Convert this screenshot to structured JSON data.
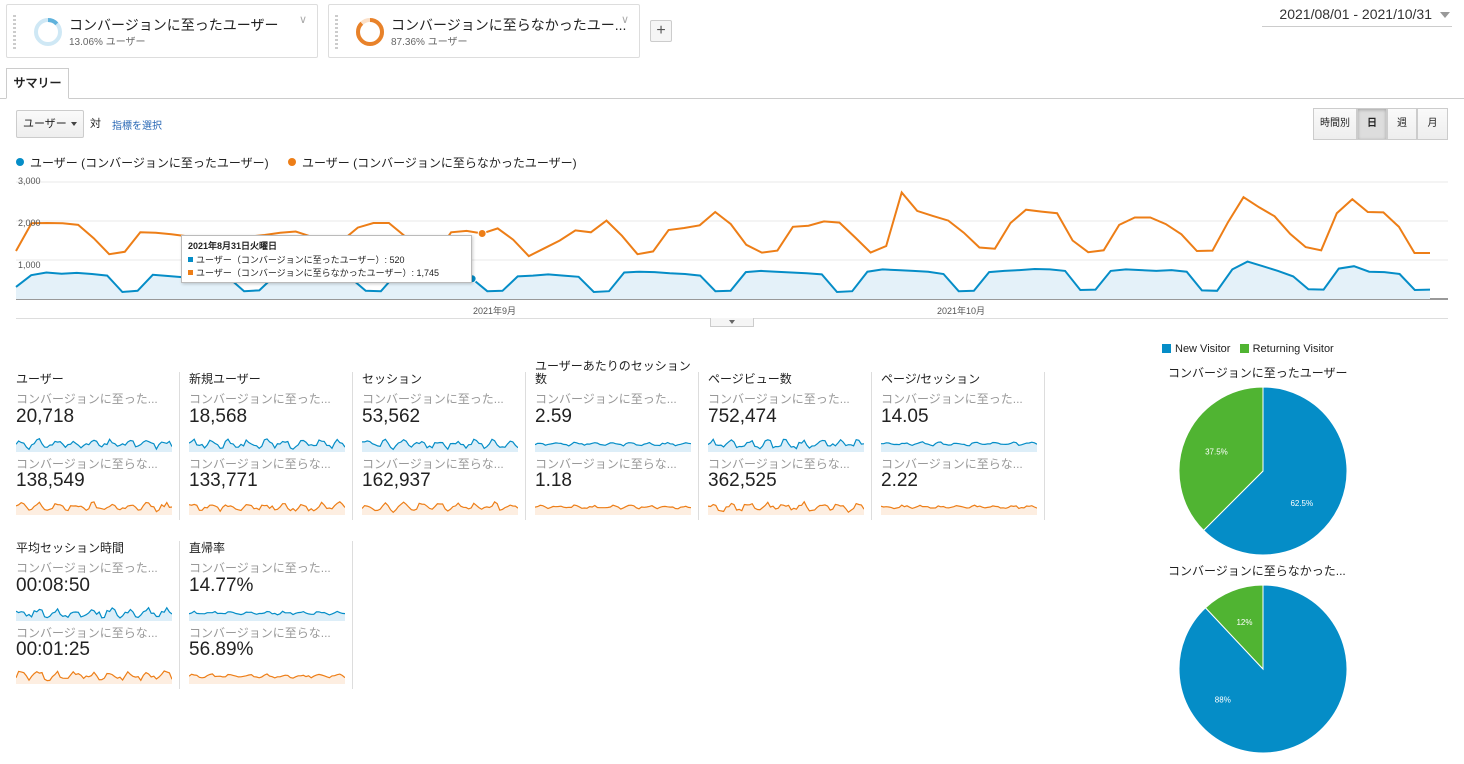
{
  "segments": [
    {
      "name": "コンバージョンに至ったユーザー",
      "pct": "13.06% ユーザー",
      "color": "#5fb2dc"
    },
    {
      "name": "コンバージョンに至らなかったユー...",
      "pct": "87.36% ユーザー",
      "color": "#e8822a"
    }
  ],
  "add_label": "+",
  "date_range": "2021/08/01 - 2021/10/31",
  "tab_label": "サマリー",
  "metric_select": "ユーザー",
  "vs_label": "対",
  "choose_metric": "指標を選択",
  "granularity": [
    "時間別",
    "日",
    "週",
    "月"
  ],
  "granularity_selected": "日",
  "legend": {
    "series1": "ユーザー (コンバージョンに至ったユーザー)",
    "series2": "ユーザー (コンバージョンに至らなかったユーザー)"
  },
  "tooltip": {
    "title": "2021年8月31日火曜日",
    "row1": "ユーザー（コンバージョンに至ったユーザー）: 520",
    "row2": "ユーザー（コンバージョンに至らなかったユーザー）: 1,745"
  },
  "chart_data": {
    "type": "line",
    "x_start": "2021/08/01",
    "x_end": "2021/10/31",
    "yticks": [
      "3,000",
      "2,000",
      "1,000"
    ],
    "xticks": [
      "2021年9月",
      "2021年10月"
    ],
    "ylim": [
      0,
      3000
    ],
    "series": [
      {
        "name": "ユーザー (コンバージョンに至ったユーザー)",
        "color": "#058dc7",
        "values": [
          310,
          610,
          680,
          650,
          670,
          640,
          600,
          180,
          210,
          620,
          590,
          560,
          600,
          580,
          540,
          200,
          220,
          590,
          600,
          610,
          580,
          570,
          540,
          210,
          200,
          640,
          660,
          640,
          610,
          580,
          520,
          200,
          210,
          580,
          600,
          630,
          600,
          570,
          180,
          200,
          680,
          700,
          690,
          660,
          640,
          600,
          200,
          210,
          690,
          720,
          700,
          680,
          660,
          630,
          180,
          200,
          700,
          760,
          740,
          720,
          700,
          640,
          200,
          210,
          690,
          720,
          740,
          770,
          760,
          720,
          230,
          240,
          720,
          760,
          740,
          720,
          740,
          700,
          220,
          210,
          760,
          960,
          840,
          720,
          580,
          250,
          240,
          780,
          840,
          700,
          690,
          640,
          230,
          240
        ]
      },
      {
        "name": "ユーザー (コンバージョンに至らなかったユーザー)",
        "color": "#ed7e17",
        "values": [
          1230,
          1940,
          1950,
          1940,
          1900,
          1560,
          1150,
          1210,
          1710,
          1700,
          1660,
          1610,
          1540,
          1130,
          1190,
          1600,
          1640,
          1700,
          1730,
          1600,
          1300,
          1500,
          1830,
          1950,
          1950,
          1620,
          1200,
          1130,
          1710,
          1745,
          1680,
          1810,
          1520,
          1100,
          1300,
          1500,
          1760,
          1710,
          2010,
          1620,
          1150,
          1220,
          1770,
          1820,
          1890,
          2230,
          1920,
          1390,
          1190,
          1240,
          1850,
          1880,
          1990,
          1960,
          1580,
          1190,
          1360,
          2730,
          2260,
          2130,
          2010,
          1700,
          1320,
          1290,
          1950,
          2290,
          2240,
          2200,
          1500,
          1200,
          1250,
          1900,
          2090,
          2090,
          1920,
          1660,
          1230,
          1240,
          1970,
          2610,
          2350,
          2120,
          1670,
          1330,
          1250,
          2200,
          2560,
          2230,
          2220,
          1850,
          1180,
          1180
        ]
      }
    ]
  },
  "metrics": [
    {
      "title": "ユーザー",
      "s1_label": "コンバージョンに至った...",
      "s1_value": "20,718",
      "s2_label": "コンバージョンに至らな...",
      "s2_value": "138,549"
    },
    {
      "title": "新規ユーザー",
      "s1_label": "コンバージョンに至った...",
      "s1_value": "18,568",
      "s2_label": "コンバージョンに至らな...",
      "s2_value": "133,771"
    },
    {
      "title": "セッション",
      "s1_label": "コンバージョンに至った...",
      "s1_value": "53,562",
      "s2_label": "コンバージョンに至らな...",
      "s2_value": "162,937"
    },
    {
      "title": "ユーザーあたりのセッション数",
      "s1_label": "コンバージョンに至った...",
      "s1_value": "2.59",
      "s2_label": "コンバージョンに至らな...",
      "s2_value": "1.18"
    },
    {
      "title": "ページビュー数",
      "s1_label": "コンバージョンに至った...",
      "s1_value": "752,474",
      "s2_label": "コンバージョンに至らな...",
      "s2_value": "362,525"
    },
    {
      "title": "ページ/セッション",
      "s1_label": "コンバージョンに至った...",
      "s1_value": "14.05",
      "s2_label": "コンバージョンに至らな...",
      "s2_value": "2.22"
    },
    {
      "title": "平均セッション時間",
      "s1_label": "コンバージョンに至った...",
      "s1_value": "00:08:50",
      "s2_label": "コンバージョンに至らな...",
      "s2_value": "00:01:25"
    },
    {
      "title": "直帰率",
      "s1_label": "コンバージョンに至った...",
      "s1_value": "14.77%",
      "s2_label": "コンバージョンに至らな...",
      "s2_value": "56.89%"
    }
  ],
  "pie_legend": [
    "New Visitor",
    "Returning Visitor"
  ],
  "pie_colors": [
    "#058dc7",
    "#50b432"
  ],
  "pies": [
    {
      "title": "コンバージョンに至ったユーザー",
      "new_pct": 62.5,
      "returning_pct": 37.5,
      "new_label": "62.5%",
      "returning_label": "37.5%"
    },
    {
      "title": "コンバージョンに至らなかった...",
      "new_pct": 88,
      "returning_pct": 12,
      "new_label": "88%",
      "returning_label": "12%"
    }
  ]
}
